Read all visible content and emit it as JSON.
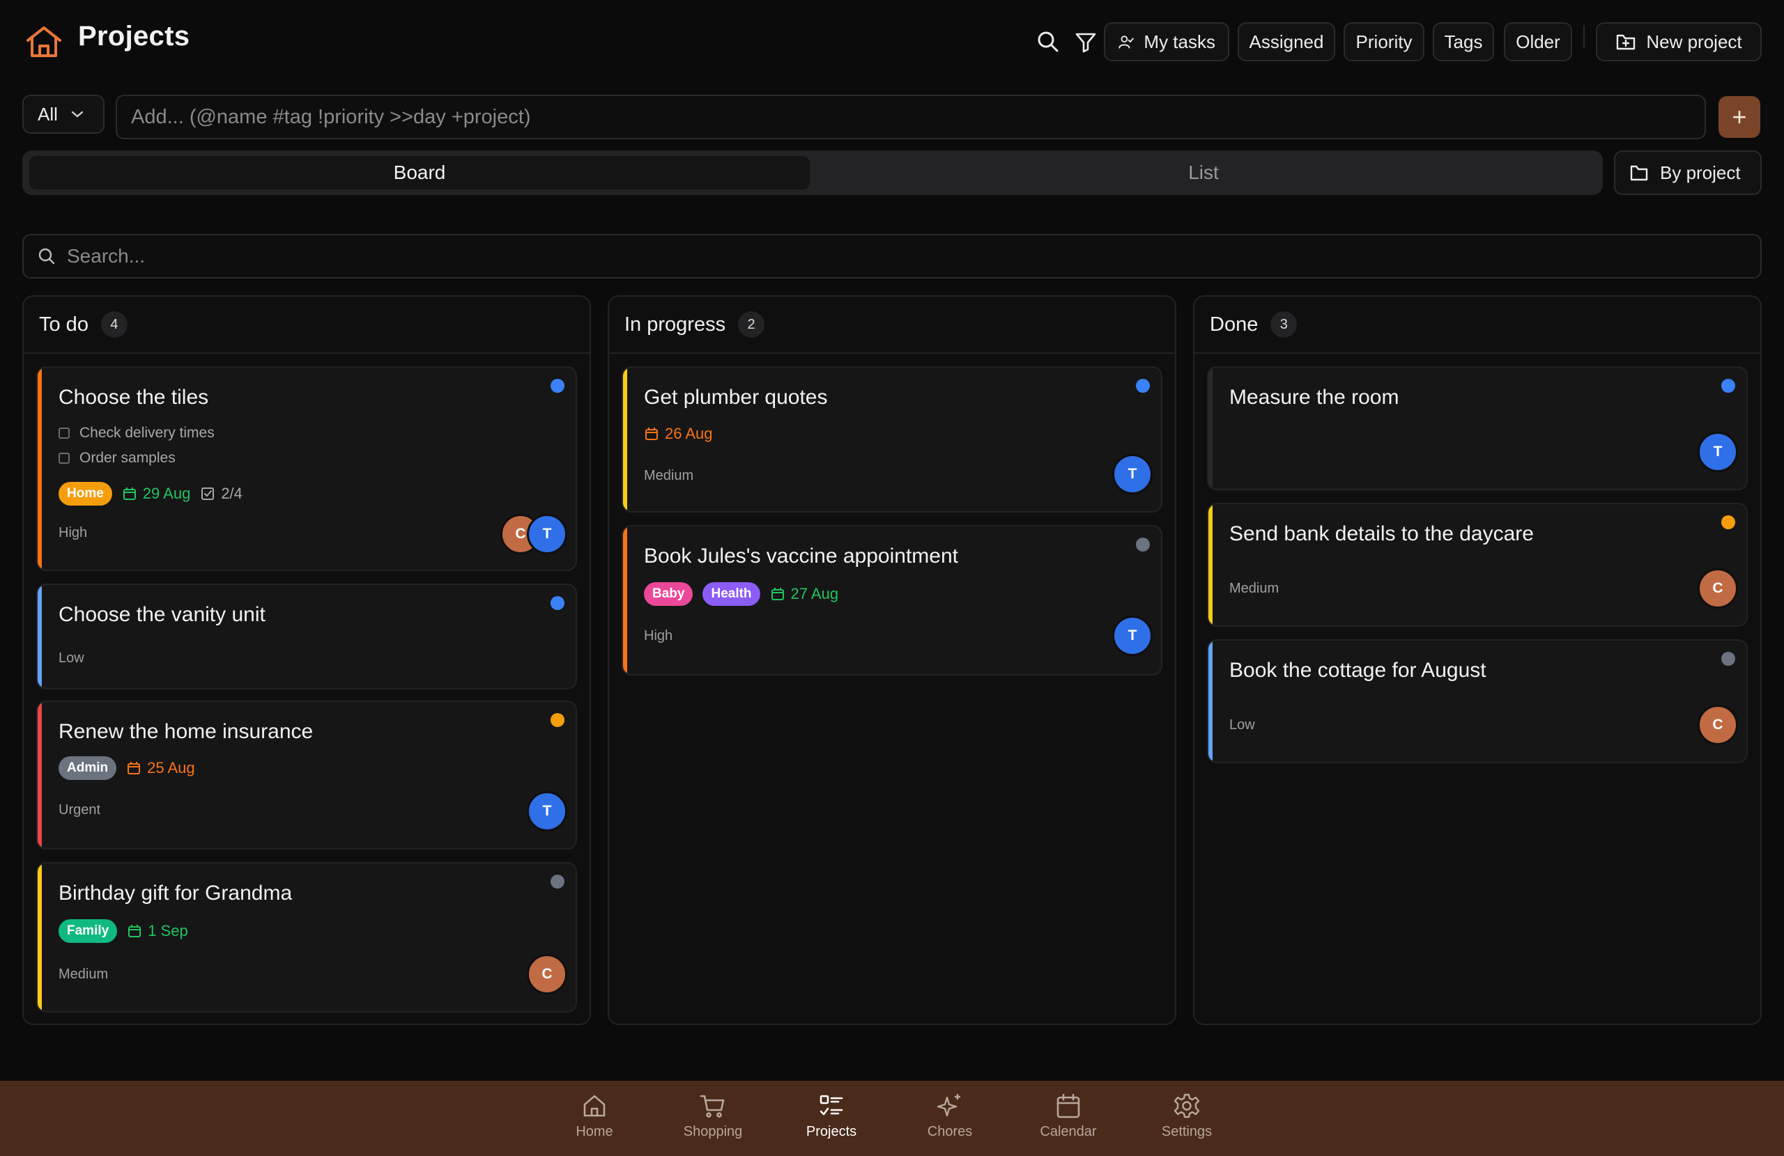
{
  "header": {
    "title": "Projects",
    "buttons": {
      "my_tasks": "My tasks",
      "assigned": "Assigned",
      "priority": "Priority",
      "tags": "Tags",
      "older": "Older",
      "new_project": "New project"
    }
  },
  "add_row": {
    "scope": "All",
    "placeholder": "Add... (@name #tag !priority >>day +project)",
    "add_symbol": "+"
  },
  "view_toggle": {
    "board": "Board",
    "list": "List",
    "selected": "Board",
    "group_by": "By project"
  },
  "search": {
    "placeholder": "Search..."
  },
  "columns": [
    {
      "title": "To do",
      "count": "4",
      "cards": [
        {
          "title": "Choose the tiles",
          "checklist": [
            "Check delivery times",
            "Order samples"
          ],
          "tags": [
            "Home"
          ],
          "date": "29 Aug",
          "subtasks": "2/4",
          "priority": "High",
          "avatars": [
            "C",
            "T"
          ]
        },
        {
          "title": "Choose the vanity unit",
          "priority": "Low"
        },
        {
          "title": "Renew the home insurance",
          "tags": [
            "Admin"
          ],
          "date": "25 Aug",
          "priority": "Urgent",
          "avatars": [
            "T"
          ]
        },
        {
          "title": "Birthday gift for Grandma",
          "tags": [
            "Family"
          ],
          "date": "1 Sep",
          "priority": "Medium",
          "avatars": [
            "C"
          ]
        }
      ]
    },
    {
      "title": "In progress",
      "count": "2",
      "cards": [
        {
          "title": "Get plumber quotes",
          "date": "26 Aug",
          "priority": "Medium",
          "avatars": [
            "T"
          ]
        },
        {
          "title": "Book Jules's vaccine appointment",
          "tags": [
            "Baby",
            "Health"
          ],
          "date": "27 Aug",
          "priority": "High",
          "avatars": [
            "T"
          ]
        }
      ]
    },
    {
      "title": "Done",
      "count": "3",
      "cards": [
        {
          "title": "Measure the room",
          "avatars": [
            "T"
          ]
        },
        {
          "title": "Send bank details to the daycare",
          "priority": "Medium",
          "avatars": [
            "C"
          ]
        },
        {
          "title": "Book the cottage for August",
          "priority": "Low",
          "avatars": [
            "C"
          ]
        }
      ]
    }
  ],
  "bottom_nav": {
    "items": [
      {
        "label": "Home",
        "icon": "home-icon"
      },
      {
        "label": "Shopping",
        "icon": "cart-icon"
      },
      {
        "label": "Projects",
        "icon": "projects-icon"
      },
      {
        "label": "Chores",
        "icon": "sparkles-icon"
      },
      {
        "label": "Calendar",
        "icon": "calendar-icon"
      },
      {
        "label": "Settings",
        "icon": "gear-icon"
      }
    ],
    "active": "Projects"
  },
  "colors": {
    "background": "#0b0b0c",
    "accent_brown": "#7a4428",
    "nav_brown": "#4a2a1a",
    "priority_urgent": "#ef4444",
    "priority_high": "#f97316",
    "priority_medium": "#facc15",
    "priority_low": "#60a5fa",
    "tag_home": "#f59e0b",
    "tag_admin": "#6b7280",
    "tag_family": "#10b981",
    "tag_baby": "#ec4899",
    "tag_health": "#8b5cf6",
    "avatar_t": "#2f6fe8",
    "avatar_c": "#c06b43"
  }
}
